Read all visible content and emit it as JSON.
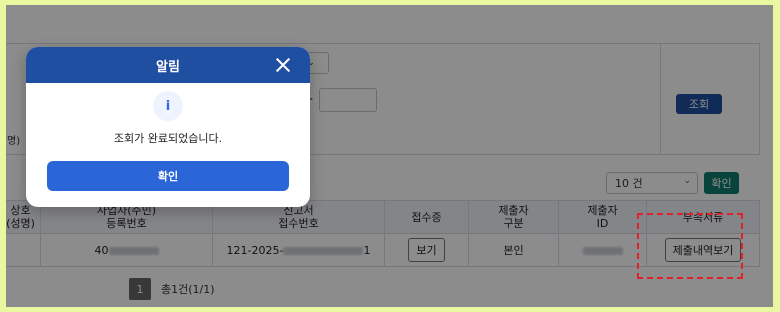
{
  "search": {
    "select_value": "",
    "date_separator": "-",
    "left_label": "명)",
    "search_button": "조회"
  },
  "list": {
    "page_size": "10 건",
    "page_size_caret": "⌄",
    "confirm_button": "확인",
    "columns": {
      "c1_line1": "상호",
      "c1_line2": "(성명)",
      "c2_line1": "사업자(주민)",
      "c2_line2": "등록번호",
      "c3_line1": "신고서",
      "c3_line2": "접수번호",
      "c4": "접수증",
      "c5_line1": "제출자",
      "c5_line2": "구분",
      "c6_line1": "제출자",
      "c6_line2": "ID",
      "c7": "부속서류"
    },
    "row": {
      "reg_prefix": "40",
      "receipt_prefix": "121-2025-",
      "receipt_suffix": "1",
      "view_button": "보기",
      "submitter_type": "본인",
      "attach_button": "제출내역보기"
    },
    "pager": {
      "page": "1",
      "total": "총1건(1/1)"
    }
  },
  "modal": {
    "title": "알림",
    "icon": "info-icon",
    "icon_glyph": "i",
    "message": "조회가 완료되었습니다.",
    "ok_button": "확인"
  },
  "colors": {
    "header_blue": "#1f4fa0",
    "ok_blue": "#2a66d8",
    "teal": "#0f7d6e",
    "highlight_red": "#e0202a",
    "frame_lime": "#e8f7a0"
  }
}
